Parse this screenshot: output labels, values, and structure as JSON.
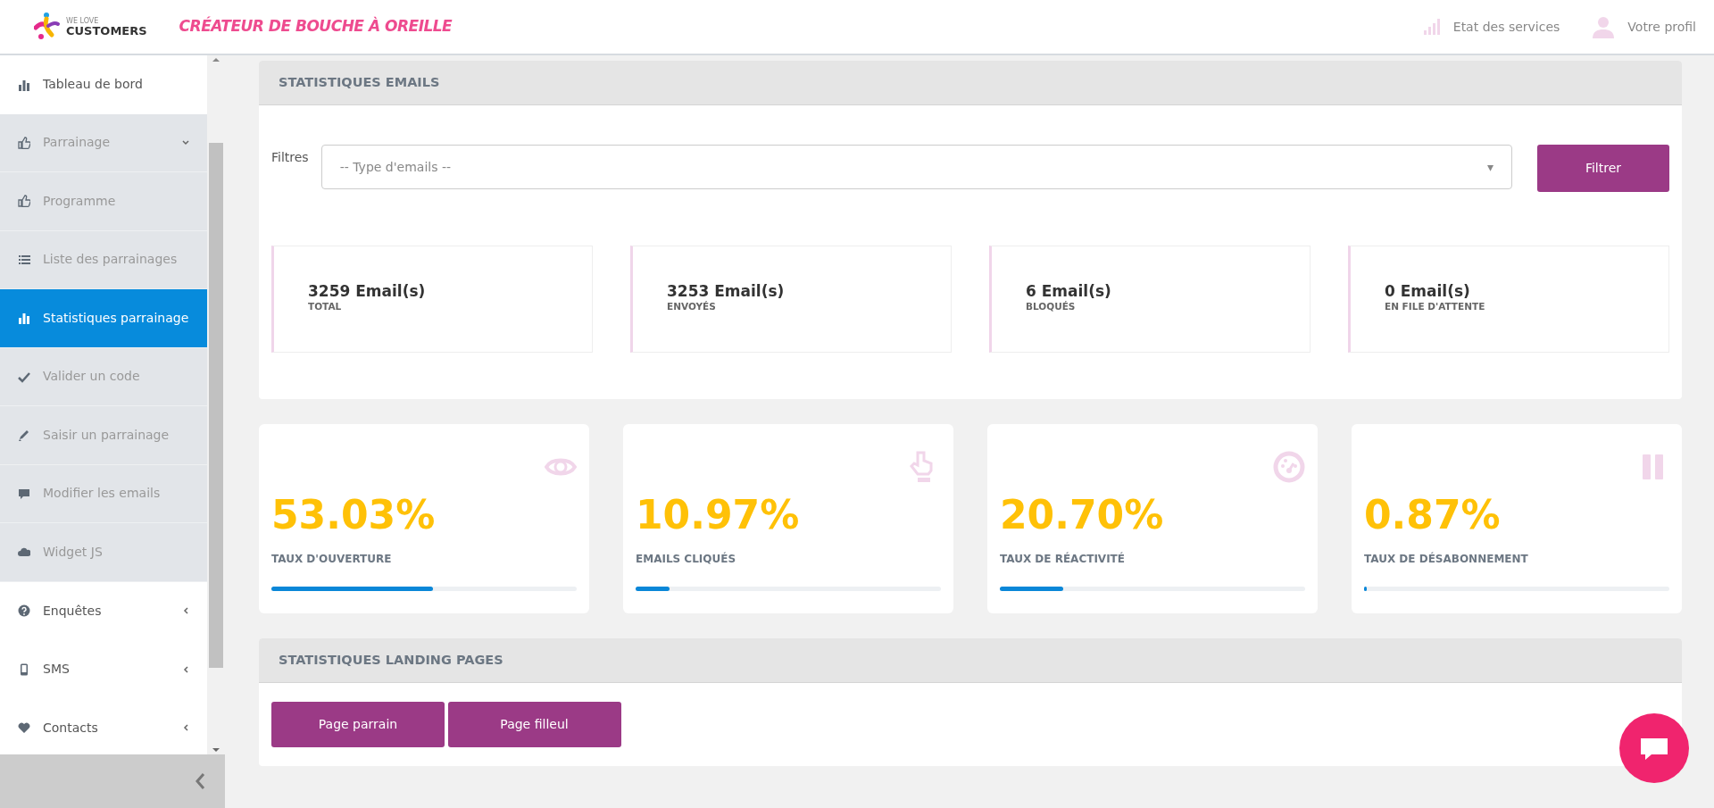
{
  "header": {
    "logo_top": "WE LOVE",
    "logo_bottom": "CUSTOMERS",
    "tagline": "CRÉATEUR DE BOUCHE À OREILLE",
    "links": [
      "Etat des services",
      "Votre profil"
    ]
  },
  "sidebar": {
    "items": [
      {
        "label": "Tableau de bord",
        "selected": false
      },
      {
        "label": "Parrainage",
        "selected": false,
        "expanded": true,
        "children": [
          {
            "label": "Programme",
            "selected": false
          },
          {
            "label": "Liste des parrainages",
            "selected": false
          },
          {
            "label": "Statistiques parrainage",
            "selected": true
          },
          {
            "label": "Valider un code",
            "selected": false
          },
          {
            "label": "Saisir un parrainage",
            "selected": false
          },
          {
            "label": "Modifier les emails",
            "selected": false
          },
          {
            "label": "Widget JS",
            "selected": false
          }
        ]
      },
      {
        "label": "Enquêtes",
        "selected": false,
        "expanded": false
      },
      {
        "label": "SMS",
        "selected": false,
        "expanded": false
      },
      {
        "label": "Contacts",
        "selected": false,
        "expanded": false
      }
    ]
  },
  "emails_panel": {
    "title": "STATISTIQUES EMAILS",
    "filter_label": "Filtres",
    "select": {
      "placeholder": "-- Type d'emails --",
      "arrow": "▾"
    },
    "filter_button": "Filtrer",
    "totals": [
      {
        "value": "3259 Email(s)",
        "label": "TOTAL"
      },
      {
        "value": "3253 Email(s)",
        "label": "ENVOYÉS"
      },
      {
        "value": "6 Email(s)",
        "label": "BLOQUÉS"
      },
      {
        "value": "0 Email(s)",
        "label": "EN FILE D'ATTENTE"
      }
    ]
  },
  "metrics": [
    {
      "value": "53.03%",
      "label": "TAUX D'OUVERTURE",
      "level": 0.5303
    },
    {
      "value": "10.97%",
      "label": "EMAILS CLIQUÉS",
      "level": 0.1097
    },
    {
      "value": "20.70%",
      "label": "TAUX DE RÉACTIVITÉ",
      "level": 0.207
    },
    {
      "value": "0.87%",
      "label": "TAUX DE DÉSABONNEMENT",
      "level": 0.0087
    }
  ],
  "landing_panel": {
    "title": "STATISTIQUES LANDING PAGES",
    "buttons": [
      "Page parrain",
      "Page filleul"
    ]
  }
}
